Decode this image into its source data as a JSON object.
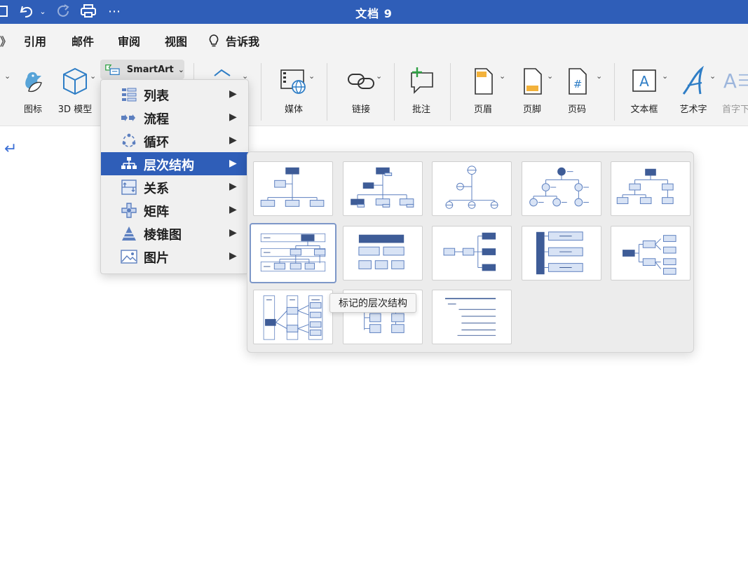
{
  "window": {
    "title": "文档 9"
  },
  "titlebar": {
    "more": "⋯"
  },
  "tabs": [
    {
      "label": "引用"
    },
    {
      "label": "邮件"
    },
    {
      "label": "审阅"
    },
    {
      "label": "视图"
    },
    {
      "label": "告诉我"
    }
  ],
  "ribbon": {
    "smartart_label": "SmartArt",
    "items": [
      {
        "label": "图标"
      },
      {
        "label": "3D 模型"
      },
      {
        "label": "媒体"
      },
      {
        "label": "链接"
      },
      {
        "label": "批注"
      },
      {
        "label": "页眉"
      },
      {
        "label": "页脚"
      },
      {
        "label": "页码"
      },
      {
        "label": "文本框"
      },
      {
        "label": "艺术字"
      },
      {
        "label": "首字下"
      }
    ]
  },
  "smartart_menu": {
    "items": [
      {
        "label": "列表",
        "icon": "list-icon"
      },
      {
        "label": "流程",
        "icon": "process-icon"
      },
      {
        "label": "循环",
        "icon": "cycle-icon"
      },
      {
        "label": "层次结构",
        "icon": "hierarchy-icon",
        "active": true
      },
      {
        "label": "关系",
        "icon": "relationship-icon"
      },
      {
        "label": "矩阵",
        "icon": "matrix-icon"
      },
      {
        "label": "棱锥图",
        "icon": "pyramid-icon"
      },
      {
        "label": "图片",
        "icon": "picture-icon"
      }
    ]
  },
  "gallery": {
    "tooltip": "标记的层次结构"
  },
  "colors": {
    "title_bar": "#2f5eb8",
    "accent": "#3e5c97",
    "thumb_box_fill": "#d8e3f5",
    "thumb_box_stroke": "#5c7fbf"
  }
}
